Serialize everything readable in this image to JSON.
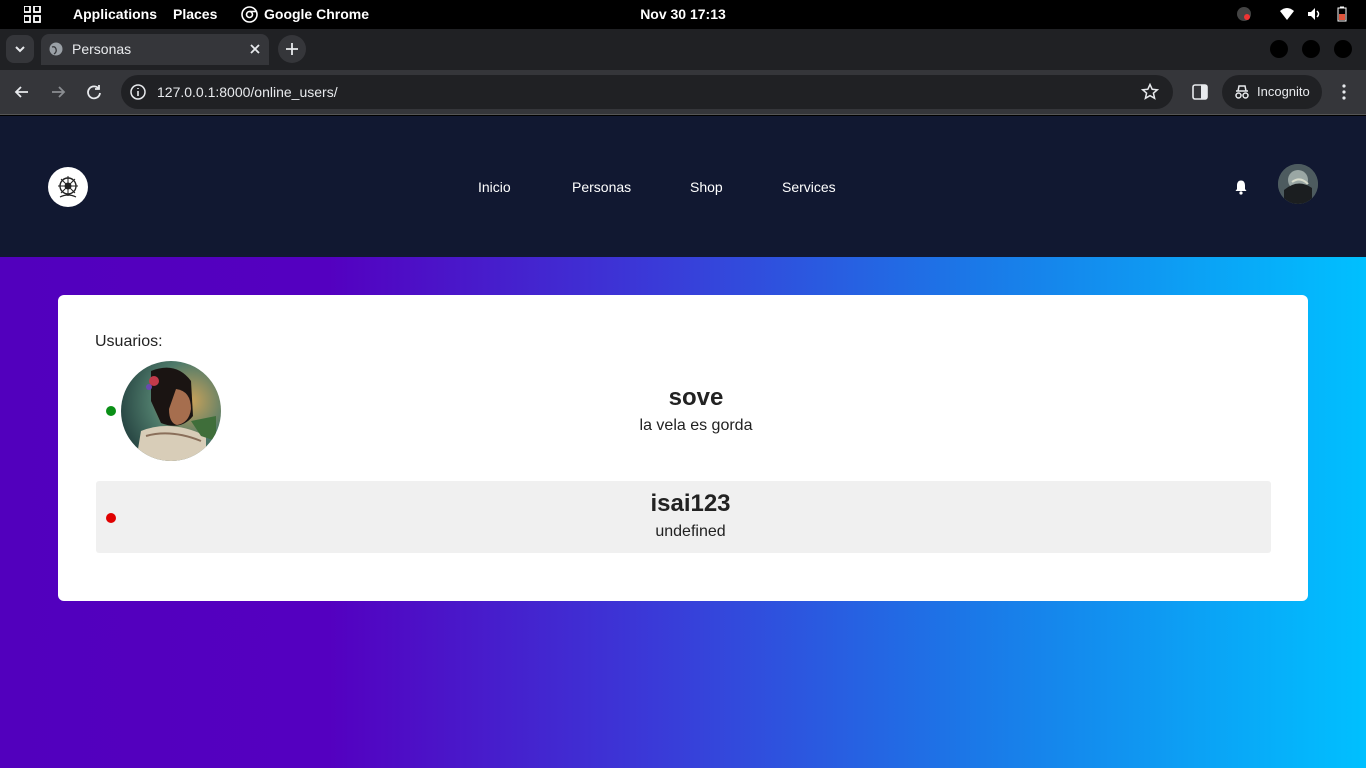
{
  "system_bar": {
    "applications": "Applications",
    "places": "Places",
    "app_name": "Google Chrome",
    "clock": "Nov 30  17:13"
  },
  "browser": {
    "tab_title": "Personas",
    "url": "127.0.0.1:8000/online_users/",
    "incognito_label": "Incognito"
  },
  "nav": {
    "links": [
      "Inicio",
      "Personas",
      "Shop",
      "Services"
    ]
  },
  "content": {
    "heading": "Usuarios:",
    "users": [
      {
        "name": "sove",
        "status": "la vela es gorda",
        "online": true,
        "status_color": "#0a8f16"
      },
      {
        "name": "isai123",
        "status": "undefined",
        "online": false,
        "status_color": "#e00000"
      }
    ]
  },
  "colors": {
    "navbar": "#111831",
    "gradient_start": "#5200bd",
    "gradient_end": "#00c0ff",
    "online": "#0a8f16",
    "offline": "#e00000"
  }
}
